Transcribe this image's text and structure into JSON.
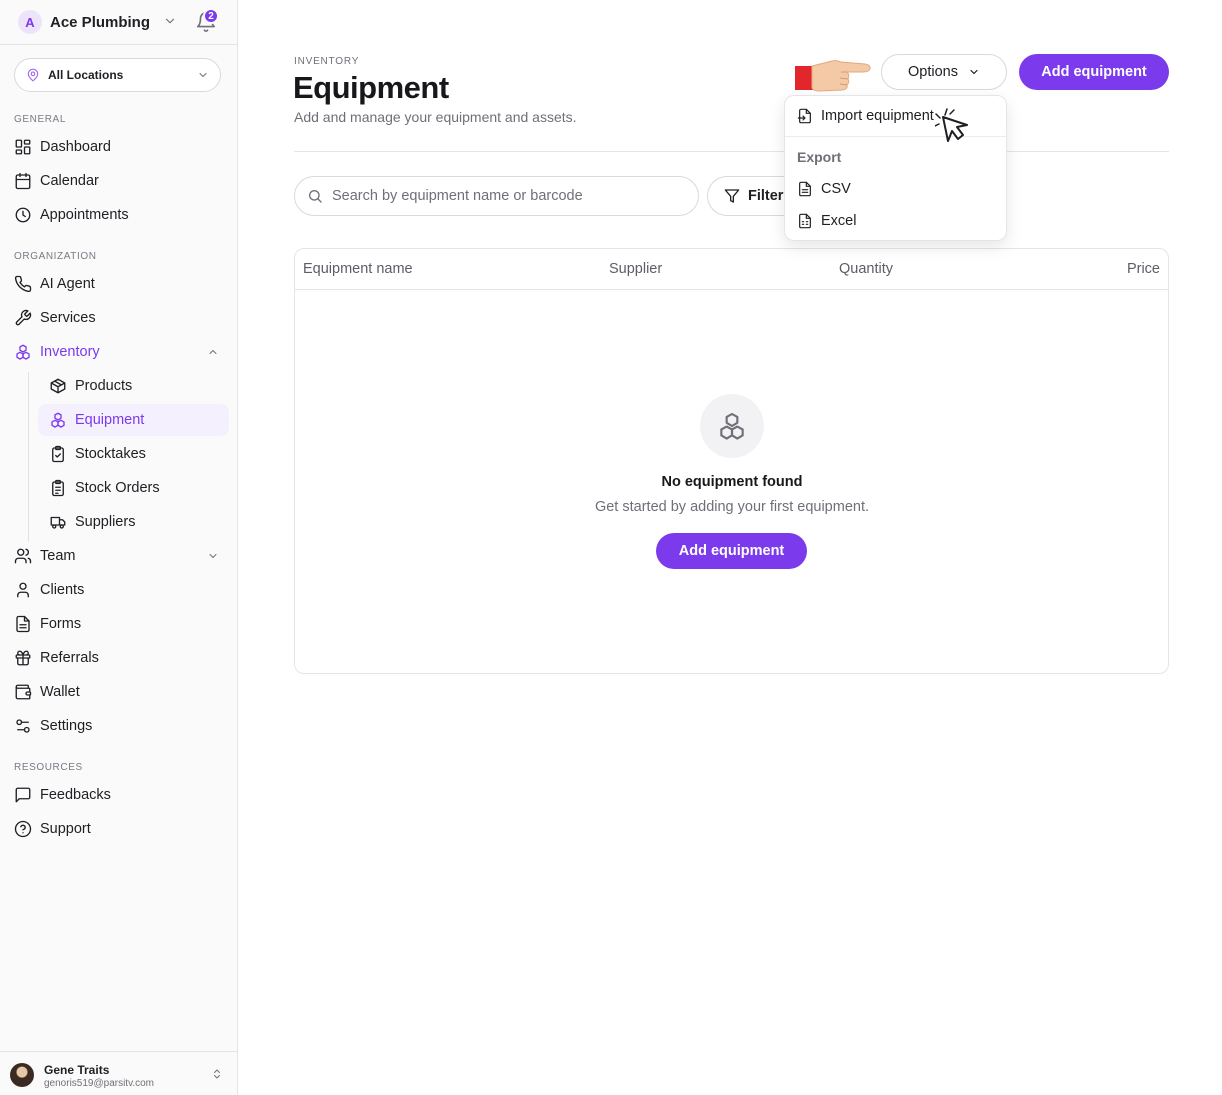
{
  "sidebar": {
    "org": {
      "avatar": "A",
      "name": "Ace Plumbing",
      "notifications": "2"
    },
    "location": "All Locations",
    "sections": {
      "general": "GENERAL",
      "organization": "ORGANIZATION",
      "resources": "RESOURCES"
    },
    "items": {
      "dashboard": "Dashboard",
      "calendar": "Calendar",
      "appointments": "Appointments",
      "ai_agent": "AI Agent",
      "services": "Services",
      "inventory": "Inventory",
      "products": "Products",
      "equipment": "Equipment",
      "stocktakes": "Stocktakes",
      "stock_orders": "Stock Orders",
      "suppliers": "Suppliers",
      "team": "Team",
      "clients": "Clients",
      "forms": "Forms",
      "referrals": "Referrals",
      "wallet": "Wallet",
      "settings": "Settings",
      "feedbacks": "Feedbacks",
      "support": "Support"
    },
    "user": {
      "name": "Gene Traits",
      "email": "genoris519@parsitv.com"
    }
  },
  "header": {
    "eyebrow": "INVENTORY",
    "title": "Equipment",
    "subtitle": "Add and manage your equipment and assets.",
    "options_label": "Options",
    "add_label": "Add equipment"
  },
  "toolbar": {
    "search_placeholder": "Search by equipment name or barcode",
    "filters_label": "Filters"
  },
  "table": {
    "columns": [
      "Equipment name",
      "Supplier",
      "Quantity",
      "Price"
    ],
    "rows": []
  },
  "empty_state": {
    "title": "No equipment found",
    "description": "Get started by adding your first equipment.",
    "button": "Add equipment"
  },
  "options_menu": {
    "import": "Import equipment",
    "export_heading": "Export",
    "csv": "CSV",
    "excel": "Excel"
  },
  "colors": {
    "accent": "#7c3aed",
    "accent_soft": "#f5f0fd",
    "border": "#e5e5e8",
    "muted_text": "#6f6f78"
  }
}
